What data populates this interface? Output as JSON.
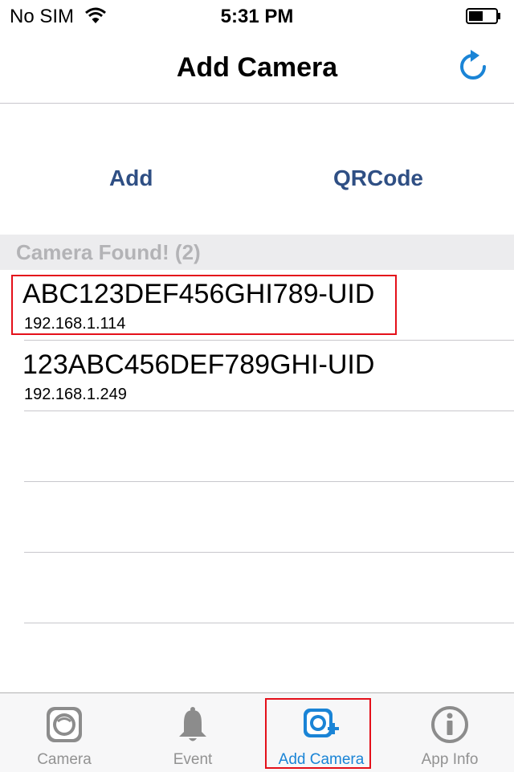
{
  "status_bar": {
    "carrier": "No SIM",
    "time": "5:31 PM",
    "wifi_icon": "wifi-icon",
    "battery_icon": "battery-icon"
  },
  "nav": {
    "title": "Add Camera",
    "refresh_icon": "refresh-icon"
  },
  "actions": {
    "add_label": "Add",
    "qrcode_label": "QRCode"
  },
  "section": {
    "header": "Camera Found! (2)"
  },
  "cameras": [
    {
      "uid": "ABC123DEF456GHI789-UID",
      "ip": "192.168.1.114",
      "highlighted": true
    },
    {
      "uid": "123ABC456DEF789GHI-UID",
      "ip": "192.168.1.249",
      "highlighted": false
    }
  ],
  "tabs": [
    {
      "label": "Camera",
      "icon": "camera-icon",
      "active": false
    },
    {
      "label": "Event",
      "icon": "bell-icon",
      "active": false
    },
    {
      "label": "Add Camera",
      "icon": "add-camera-icon",
      "active": true
    },
    {
      "label": "App Info",
      "icon": "info-icon",
      "active": false
    }
  ],
  "colors": {
    "accent": "#1a84d6",
    "action_text": "#2f4f84",
    "highlight": "#e4101a",
    "inactive_tab": "#929292"
  }
}
